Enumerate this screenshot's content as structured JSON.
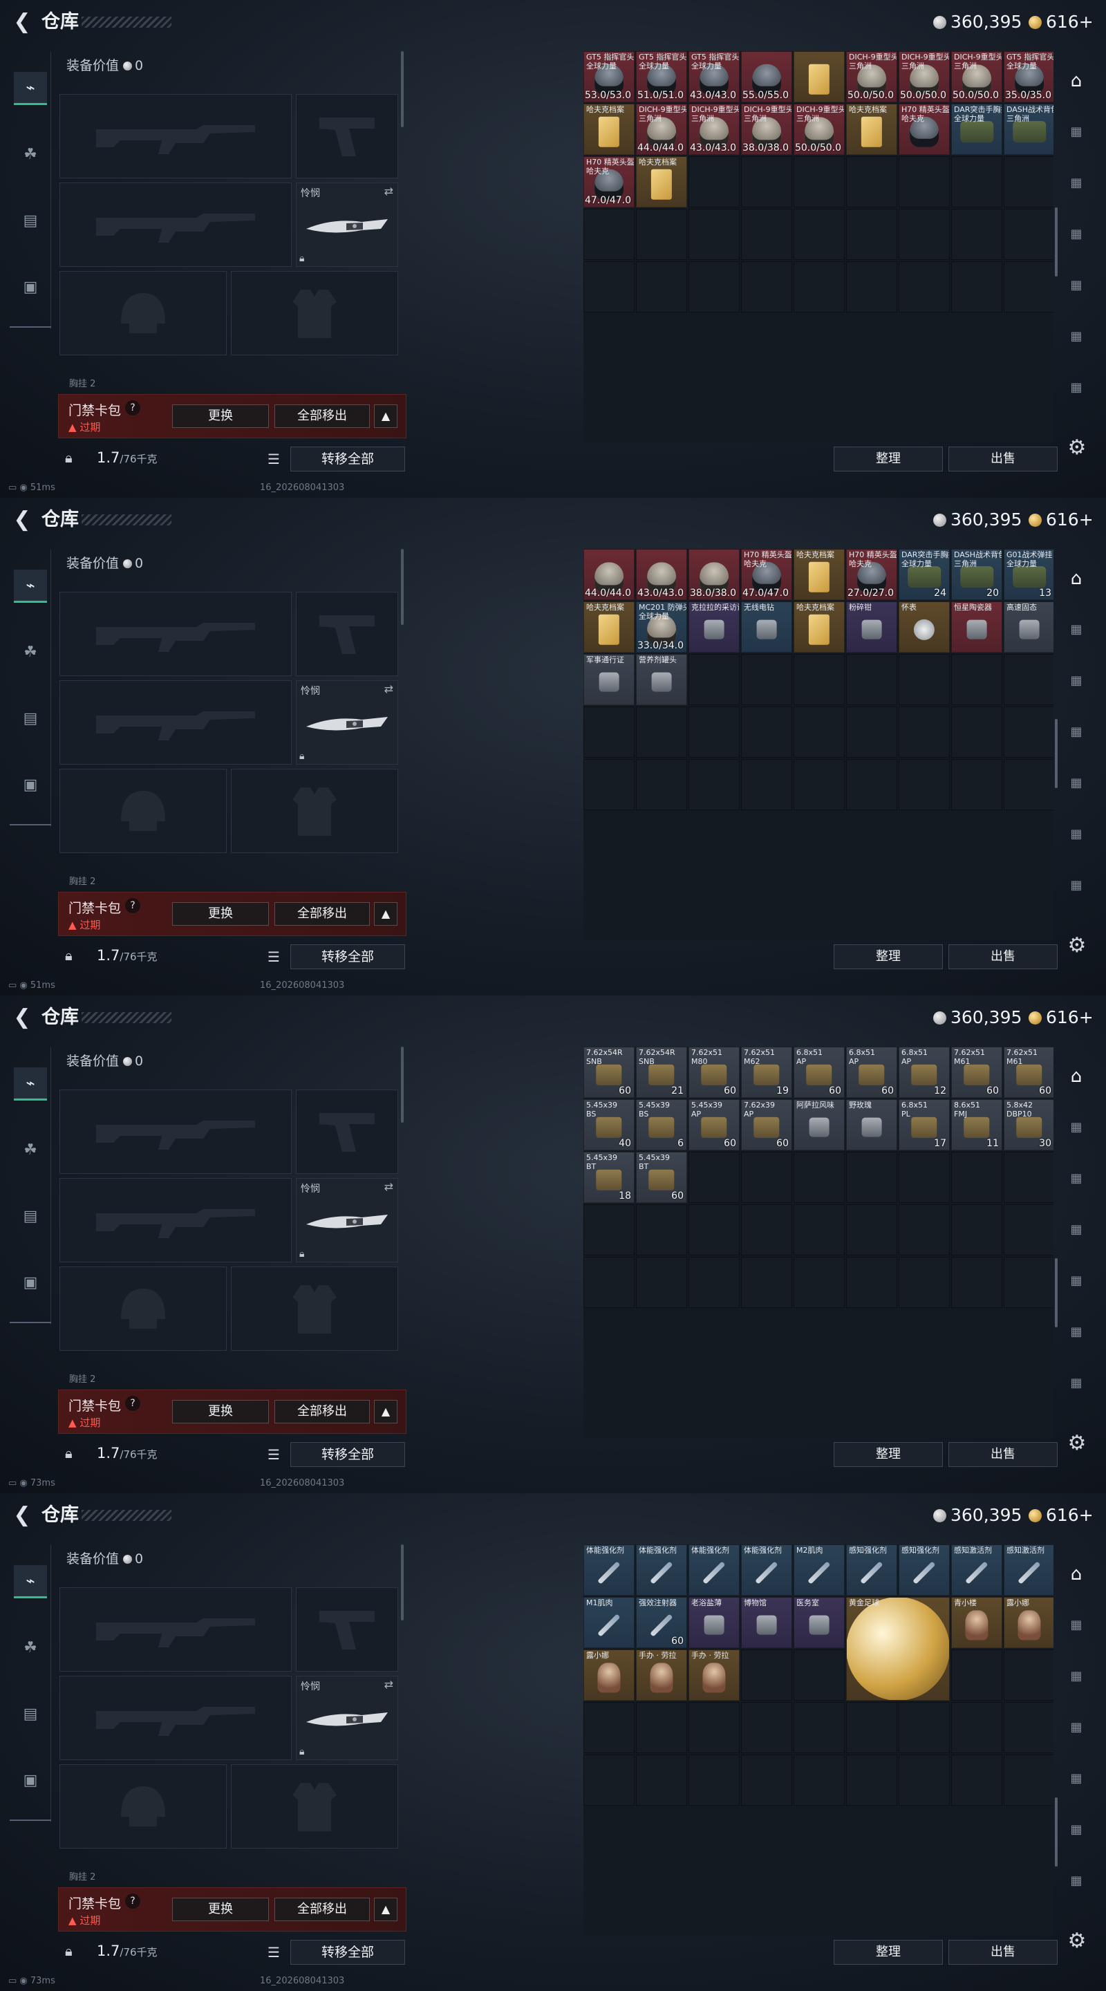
{
  "screens": [
    {
      "title": "仓库",
      "currency": {
        "silver": "360,395",
        "gold": "616+"
      },
      "equip_value_label": "装备价值",
      "equip_value": "0",
      "knife_label": "怜悯",
      "cut_label": "胸挂 2",
      "card": {
        "name": "门禁卡包",
        "expired": "过期",
        "replace": "更换",
        "move_all": "全部移出"
      },
      "weight": {
        "value": "1.7",
        "max": "/76千克"
      },
      "transfer_all": "转移全部",
      "sort": "整理",
      "sell": "出售",
      "ping": "51ms",
      "build_id": "16_202608041303",
      "items": [
        {
          "name": "GT5 指挥官头盔\n全球力量",
          "value": "53.0/53.0",
          "color": "red",
          "icon": "helmet-dark"
        },
        {
          "name": "GT5 指挥官头盔\n全球力量",
          "value": "51.0/51.0",
          "color": "red",
          "icon": "helmet-dark"
        },
        {
          "name": "GT5 指挥官头盔\n全球力量",
          "value": "43.0/43.0",
          "color": "red",
          "icon": "helmet-dark"
        },
        {
          "name": "",
          "value": "55.0/55.0",
          "color": "red",
          "icon": "helmet-dark"
        },
        {
          "name": "",
          "value": "",
          "color": "gold",
          "icon": "paper"
        },
        {
          "name": "DICH-9重型头盔\n三角洲",
          "value": "50.0/50.0",
          "color": "red",
          "icon": "helmet"
        },
        {
          "name": "DICH-9重型头盔\n三角洲",
          "value": "50.0/50.0",
          "color": "red",
          "icon": "helmet"
        },
        {
          "name": "DICH-9重型头盔\n三角洲",
          "value": "50.0/50.0",
          "color": "red",
          "icon": "helmet"
        },
        {
          "name": "GT5 指挥官头盔\n全球力量",
          "value": "35.0/35.0",
          "color": "red",
          "icon": "helmet-dark"
        },
        {
          "name": "哈夫克档案",
          "value": "",
          "color": "gold",
          "icon": "paper"
        },
        {
          "name": "DICH-9重型头盔\n三角洲",
          "value": "44.0/44.0",
          "color": "red",
          "icon": "helmet"
        },
        {
          "name": "DICH-9重型头盔\n三角洲",
          "value": "43.0/43.0",
          "color": "red",
          "icon": "helmet"
        },
        {
          "name": "DICH-9重型头盔\n三角洲",
          "value": "38.0/38.0",
          "color": "red",
          "icon": "helmet"
        },
        {
          "name": "DICH-9重型头盔\n三角洲",
          "value": "50.0/50.0",
          "color": "red",
          "icon": "helmet"
        },
        {
          "name": "哈夫克档案",
          "value": "",
          "color": "gold",
          "icon": "paper"
        },
        {
          "name": "H70 精英头盔\n哈夫克",
          "value": "",
          "color": "red",
          "icon": "helmet-dark"
        },
        {
          "name": "DAR突击手胸挂\n全球力量",
          "value": "",
          "color": "blue",
          "icon": "bag"
        },
        {
          "name": "DASH战术背包\n三角洲",
          "value": "",
          "color": "blue",
          "icon": "bag"
        },
        {
          "name": "H70 精英头盔\n哈夫克",
          "value": "47.0/47.0",
          "color": "red",
          "icon": "helmet-dark"
        },
        {
          "name": "哈夫克档案",
          "value": "",
          "color": "gold",
          "icon": "paper"
        }
      ]
    },
    {
      "title": "仓库",
      "currency": {
        "silver": "360,395",
        "gold": "616+"
      },
      "equip_value_label": "装备价值",
      "equip_value": "0",
      "knife_label": "怜悯",
      "cut_label": "胸挂 2",
      "card": {
        "name": "门禁卡包",
        "expired": "过期",
        "replace": "更换",
        "move_all": "全部移出"
      },
      "weight": {
        "value": "1.7",
        "max": "/76千克"
      },
      "transfer_all": "转移全部",
      "sort": "整理",
      "sell": "出售",
      "ping": "51ms",
      "build_id": "16_202608041303",
      "items": [
        {
          "name": "",
          "value": "44.0/44.0",
          "color": "red",
          "icon": "helmet"
        },
        {
          "name": "",
          "value": "43.0/43.0",
          "color": "red",
          "icon": "helmet"
        },
        {
          "name": "",
          "value": "38.0/38.0",
          "color": "red",
          "icon": "helmet"
        },
        {
          "name": "H70 精英头盔\n哈夫克",
          "value": "47.0/47.0",
          "color": "red",
          "icon": "helmet-dark"
        },
        {
          "name": "哈夫克档案",
          "value": "",
          "color": "gold",
          "icon": "paper"
        },
        {
          "name": "H70 精英头盔\n哈夫克",
          "value": "27.0/27.0",
          "color": "red",
          "icon": "helmet-dark"
        },
        {
          "name": "DAR突击手胸挂\n全球力量",
          "value": "24",
          "color": "blue",
          "icon": "bag"
        },
        {
          "name": "DASH战术背包\n三角洲",
          "value": "20",
          "color": "blue",
          "icon": "bag"
        },
        {
          "name": "G01战术弹挂\n全球力量",
          "value": "13",
          "color": "blue",
          "icon": "bag"
        },
        {
          "name": "哈夫克档案",
          "value": "",
          "color": "gold",
          "icon": "paper"
        },
        {
          "name": "MC201 防弹头盔\n全球力量",
          "value": "33.0/34.0",
          "color": "blue",
          "icon": "helmet"
        },
        {
          "name": "克拉拉的采访设备",
          "value": "",
          "color": "purple",
          "icon": "small"
        },
        {
          "name": "无线电钻",
          "value": "",
          "color": "blue",
          "icon": "small"
        },
        {
          "name": "哈夫克档案",
          "value": "",
          "color": "gold",
          "icon": "paper"
        },
        {
          "name": "粉碎钳",
          "value": "",
          "color": "purple",
          "icon": "small"
        },
        {
          "name": "怀表",
          "value": "",
          "color": "gold",
          "icon": "coin"
        },
        {
          "name": "恒星陶瓷器",
          "value": "",
          "color": "red",
          "icon": "small"
        },
        {
          "name": "高速固态",
          "value": "",
          "color": "gray",
          "icon": "small"
        },
        {
          "name": "军事通行证",
          "value": "",
          "color": "gray",
          "icon": "small"
        },
        {
          "name": "营养剂罐头",
          "value": "",
          "color": "gray",
          "icon": "small"
        }
      ]
    },
    {
      "title": "仓库",
      "currency": {
        "silver": "360,395",
        "gold": "616+"
      },
      "equip_value_label": "装备价值",
      "equip_value": "0",
      "knife_label": "怜悯",
      "cut_label": "胸挂 2",
      "card": {
        "name": "门禁卡包",
        "expired": "过期",
        "replace": "更换",
        "move_all": "全部移出"
      },
      "weight": {
        "value": "1.7",
        "max": "/76千克"
      },
      "transfer_all": "转移全部",
      "sort": "整理",
      "sell": "出售",
      "ping": "73ms",
      "build_id": "16_202608041303",
      "items": [
        {
          "name": "7.62x54R\nSNB",
          "value": "60",
          "color": "gray",
          "icon": "box"
        },
        {
          "name": "7.62x54R\nSNB",
          "value": "21",
          "color": "gray",
          "icon": "box"
        },
        {
          "name": "7.62x51\nM80",
          "value": "60",
          "color": "gray",
          "icon": "box"
        },
        {
          "name": "7.62x51\nM62",
          "value": "19",
          "color": "gray",
          "icon": "box"
        },
        {
          "name": "6.8x51\nAP",
          "value": "60",
          "color": "gray",
          "icon": "box"
        },
        {
          "name": "6.8x51\nAP",
          "value": "60",
          "color": "gray",
          "icon": "box"
        },
        {
          "name": "6.8x51\nAP",
          "value": "12",
          "color": "gray",
          "icon": "box"
        },
        {
          "name": "7.62x51\nM61",
          "value": "60",
          "color": "gray",
          "icon": "box"
        },
        {
          "name": "7.62x51\nM61",
          "value": "60",
          "color": "gray",
          "icon": "box"
        },
        {
          "name": "5.45x39\nBS",
          "value": "40",
          "color": "gray",
          "icon": "box"
        },
        {
          "name": "5.45x39\nBS",
          "value": "6",
          "color": "gray",
          "icon": "box"
        },
        {
          "name": "5.45x39\nAP",
          "value": "60",
          "color": "gray",
          "icon": "box"
        },
        {
          "name": "7.62x39\nAP",
          "value": "60",
          "color": "gray",
          "icon": "box"
        },
        {
          "name": "阿萨拉风味",
          "value": "",
          "color": "gray",
          "icon": "small"
        },
        {
          "name": "野玫瑰",
          "value": "",
          "color": "gray",
          "icon": "small"
        },
        {
          "name": "6.8x51\nPL",
          "value": "17",
          "color": "gray",
          "icon": "box"
        },
        {
          "name": "8.6x51\nFMJ",
          "value": "11",
          "color": "gray",
          "icon": "box"
        },
        {
          "name": "5.8x42\nDBP10",
          "value": "30",
          "color": "gray",
          "icon": "box"
        },
        {
          "name": "5.45x39\nBT",
          "value": "18",
          "color": "gray",
          "icon": "box"
        },
        {
          "name": "5.45x39\nBT",
          "value": "60",
          "color": "gray",
          "icon": "box"
        }
      ]
    },
    {
      "title": "仓库",
      "currency": {
        "silver": "360,395",
        "gold": "616+"
      },
      "equip_value_label": "装备价值",
      "equip_value": "0",
      "knife_label": "怜悯",
      "cut_label": "胸挂 2",
      "card": {
        "name": "门禁卡包",
        "expired": "过期",
        "replace": "更换",
        "move_all": "全部移出"
      },
      "weight": {
        "value": "1.7",
        "max": "/76千克"
      },
      "transfer_all": "转移全部",
      "sort": "整理",
      "sell": "出售",
      "ping": "73ms",
      "build_id": "16_202608041303",
      "items": [
        {
          "name": "体能强化剂",
          "value": "",
          "color": "blue",
          "icon": "syringe"
        },
        {
          "name": "体能强化剂",
          "value": "",
          "color": "blue",
          "icon": "syringe"
        },
        {
          "name": "体能强化剂",
          "value": "",
          "color": "blue",
          "icon": "syringe"
        },
        {
          "name": "体能强化剂",
          "value": "",
          "color": "blue",
          "icon": "syringe"
        },
        {
          "name": "M2肌肉",
          "value": "",
          "color": "blue",
          "icon": "syringe"
        },
        {
          "name": "感知强化剂",
          "value": "",
          "color": "blue",
          "icon": "syringe"
        },
        {
          "name": "感知强化剂",
          "value": "",
          "color": "blue",
          "icon": "syringe"
        },
        {
          "name": "感知激活剂",
          "value": "",
          "color": "blue",
          "icon": "syringe"
        },
        {
          "name": "感知激活剂",
          "value": "",
          "color": "blue",
          "icon": "syringe"
        },
        {
          "name": "M1肌肉",
          "value": "",
          "color": "blue",
          "icon": "syringe"
        },
        {
          "name": "强效注射器",
          "value": "60",
          "color": "blue",
          "icon": "syringe"
        },
        {
          "name": "老浴盐薄",
          "value": "",
          "color": "purple",
          "icon": "small"
        },
        {
          "name": "博物馆",
          "value": "",
          "color": "purple",
          "icon": "small"
        },
        {
          "name": "医务室",
          "value": "",
          "color": "purple",
          "icon": "small"
        },
        {
          "name": "黄金足球",
          "value": "",
          "color": "gold",
          "icon": "ball"
        },
        {
          "name": "青小楼",
          "value": "",
          "color": "gold",
          "icon": "figure"
        },
        {
          "name": "露小娜",
          "value": "",
          "color": "gold",
          "icon": "figure"
        },
        {
          "name": "露小娜",
          "value": "",
          "color": "gold",
          "icon": "figure"
        },
        {
          "name": "手办 · 劳拉",
          "value": "",
          "color": "gold",
          "icon": "figure"
        },
        {
          "name": "手办 · 劳拉",
          "value": "",
          "color": "gold",
          "icon": "figure"
        }
      ]
    }
  ],
  "icons": {
    "back": "back-arrow-icon",
    "gun": "gun-icon",
    "armor": "armor-icon",
    "backpack": "backpack-icon",
    "case": "case-icon",
    "gear": "gear-icon"
  }
}
